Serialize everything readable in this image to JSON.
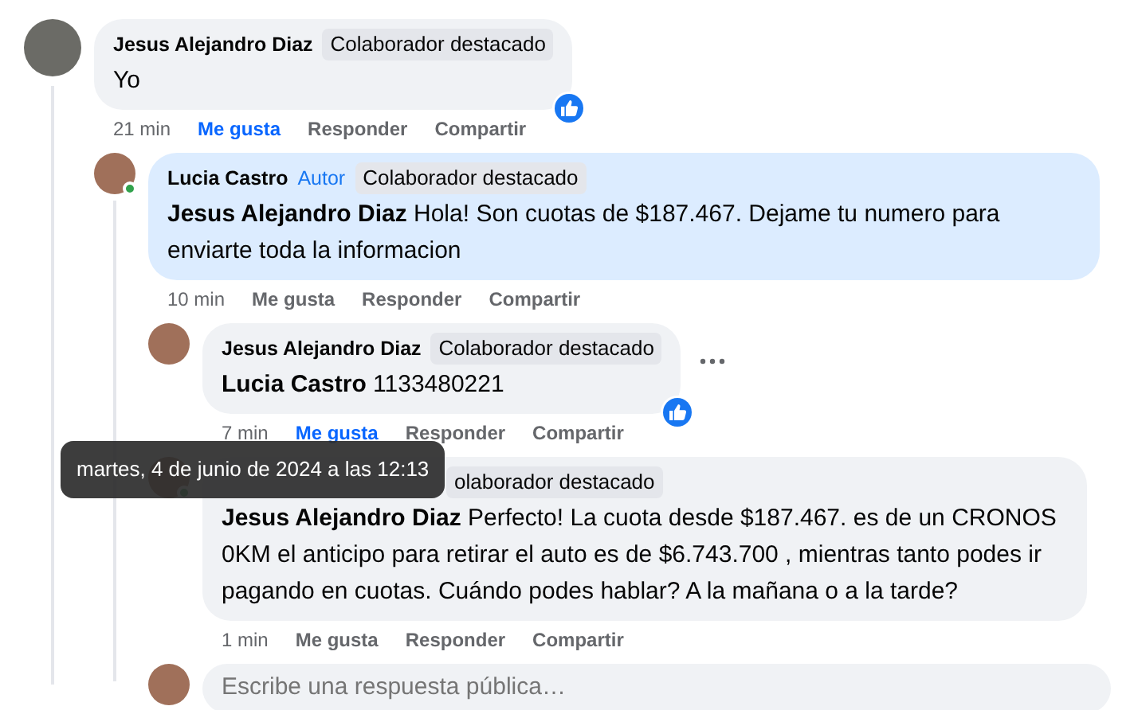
{
  "comments": [
    {
      "author": "Jesus Alejandro Diaz",
      "badge": "Colaborador destacado",
      "text": "Yo",
      "time": "21 min",
      "liked": true,
      "reaction": true,
      "actions": [
        "Me gusta",
        "Responder",
        "Compartir"
      ],
      "children": [
        {
          "author": "Lucia Castro",
          "role": "Autor",
          "badge": "Colaborador destacado",
          "mention": "Jesus Alejandro Diaz",
          "text": "Hola! Son cuotas de $187.467. Dejame tu numero para enviarte toda la informacion",
          "time": "10 min",
          "liked": false,
          "online": true,
          "highlighted": true,
          "actions": [
            "Me gusta",
            "Responder",
            "Compartir"
          ],
          "children": [
            {
              "author": "Jesus Alejandro Diaz",
              "badge": "Colaborador destacado",
              "mention": "Lucia Castro",
              "text": "1133480221",
              "time": "7 min",
              "liked": true,
              "reaction": true,
              "show_menu": true,
              "actions": [
                "Me gusta",
                "Responder",
                "Compartir"
              ]
            },
            {
              "badge": "olaborador destacado",
              "mention": "Jesus Alejandro Diaz",
              "text": "Perfecto! La cuota desde $187.467. es de un CRONOS 0KM el anticipo para retirar el auto es de $6.743.700 , mientras tanto podes ir pagando en cuotas. Cuándo podes hablar? A la mañana o a la tarde?",
              "time": "1 min",
              "liked": false,
              "online": true,
              "actions": [
                "Me gusta",
                "Responder",
                "Compartir"
              ]
            }
          ],
          "reply_box": {
            "placeholder": "Escribe una respuesta pública…"
          }
        }
      ]
    }
  ],
  "tooltip": {
    "text": "martes, 4 de junio de 2024 a las 12:13"
  }
}
